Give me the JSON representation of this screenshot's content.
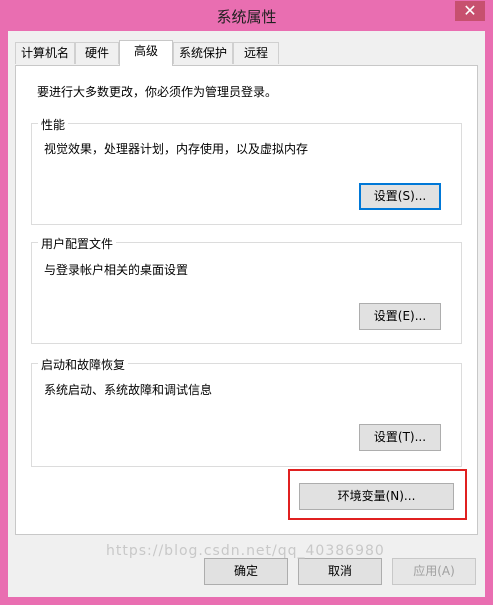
{
  "window": {
    "title": "系统属性",
    "close_glyph": "✕"
  },
  "tabs": [
    {
      "label": "计算机名",
      "active": false
    },
    {
      "label": "硬件",
      "active": false
    },
    {
      "label": "高级",
      "active": true
    },
    {
      "label": "系统保护",
      "active": false
    },
    {
      "label": "远程",
      "active": false
    }
  ],
  "advanced": {
    "intro": "要进行大多数更改，你必须作为管理员登录。",
    "performance": {
      "title": "性能",
      "description": "视觉效果，处理器计划，内存使用，以及虚拟内存",
      "button": "设置(S)..."
    },
    "user_profiles": {
      "title": "用户配置文件",
      "description": "与登录帐户相关的桌面设置",
      "button": "设置(E)..."
    },
    "startup_recovery": {
      "title": "启动和故障恢复",
      "description": "系统启动、系统故障和调试信息",
      "button": "设置(T)..."
    },
    "env_button": "环境变量(N)..."
  },
  "footer": {
    "ok": "确定",
    "cancel": "取消",
    "apply": "应用(A)"
  },
  "watermark": "https://blog.csdn.net/qq_40386980",
  "colors": {
    "frame": "#e96eb1",
    "close": "#c7506f",
    "highlight_box": "#e02020",
    "focus_border": "#0078d7"
  }
}
